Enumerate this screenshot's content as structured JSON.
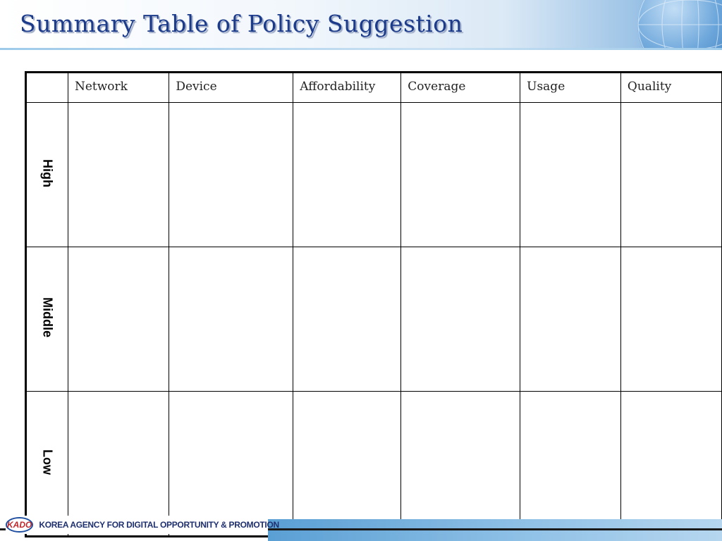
{
  "slide": {
    "title": "Summary Table of Policy Suggestion"
  },
  "table": {
    "columns": [
      "Network",
      "Device",
      "Affordability",
      "Coverage",
      "Usage",
      "Quality"
    ],
    "rows": [
      "High",
      "Middle",
      "Low"
    ]
  },
  "footer": {
    "logo_mark": "KADO",
    "organization": "KOREA AGENCY FOR DIGITAL OPPORTUNITY & PROMOTION"
  },
  "colors": {
    "title_text": "#1c3b8a",
    "footer_bar": "#5a9fd4",
    "grid_lines": "#000000"
  },
  "icons": {
    "globe": "globe-icon",
    "logo": "kado-logo-icon"
  }
}
